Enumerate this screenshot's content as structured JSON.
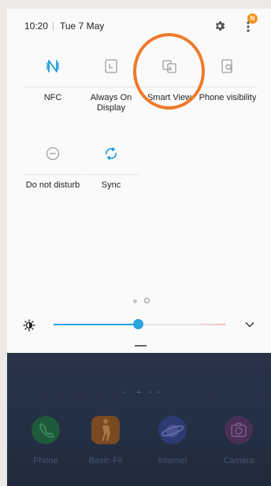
{
  "status_bar": {
    "time": "10:20",
    "separator": "|",
    "date": "Tue 7 May",
    "notification_badge": "N"
  },
  "quick_tiles": [
    {
      "label": "NFC",
      "icon": "nfc-icon",
      "active": true
    },
    {
      "label": "Always On Display",
      "icon": "always-on-display-icon",
      "active": false
    },
    {
      "label": "Smart View",
      "icon": "smart-view-icon",
      "active": false
    },
    {
      "label": "Phone visibility",
      "icon": "phone-visibility-icon",
      "active": false
    },
    {
      "label": "Do not disturb",
      "icon": "do-not-disturb-icon",
      "active": false
    },
    {
      "label": "Sync",
      "icon": "sync-icon",
      "active": true
    }
  ],
  "brightness": {
    "level_percent": 49
  },
  "page_indicator": {
    "pages": 2,
    "current": 2
  },
  "home_screen": {
    "apps": [
      {
        "label": "Phone",
        "icon": "phone-icon"
      },
      {
        "label": "Basic-Fit",
        "icon": "basic-fit-icon"
      },
      {
        "label": "Internet",
        "icon": "internet-icon"
      },
      {
        "label": "Camera",
        "icon": "camera-icon"
      }
    ]
  },
  "colors": {
    "accent": "#2aa3e0",
    "highlight": "#f07a2a",
    "badge": "#f7931e",
    "active_tile": "#1a9bd7",
    "inactive_tile": "#9e9e9e"
  }
}
